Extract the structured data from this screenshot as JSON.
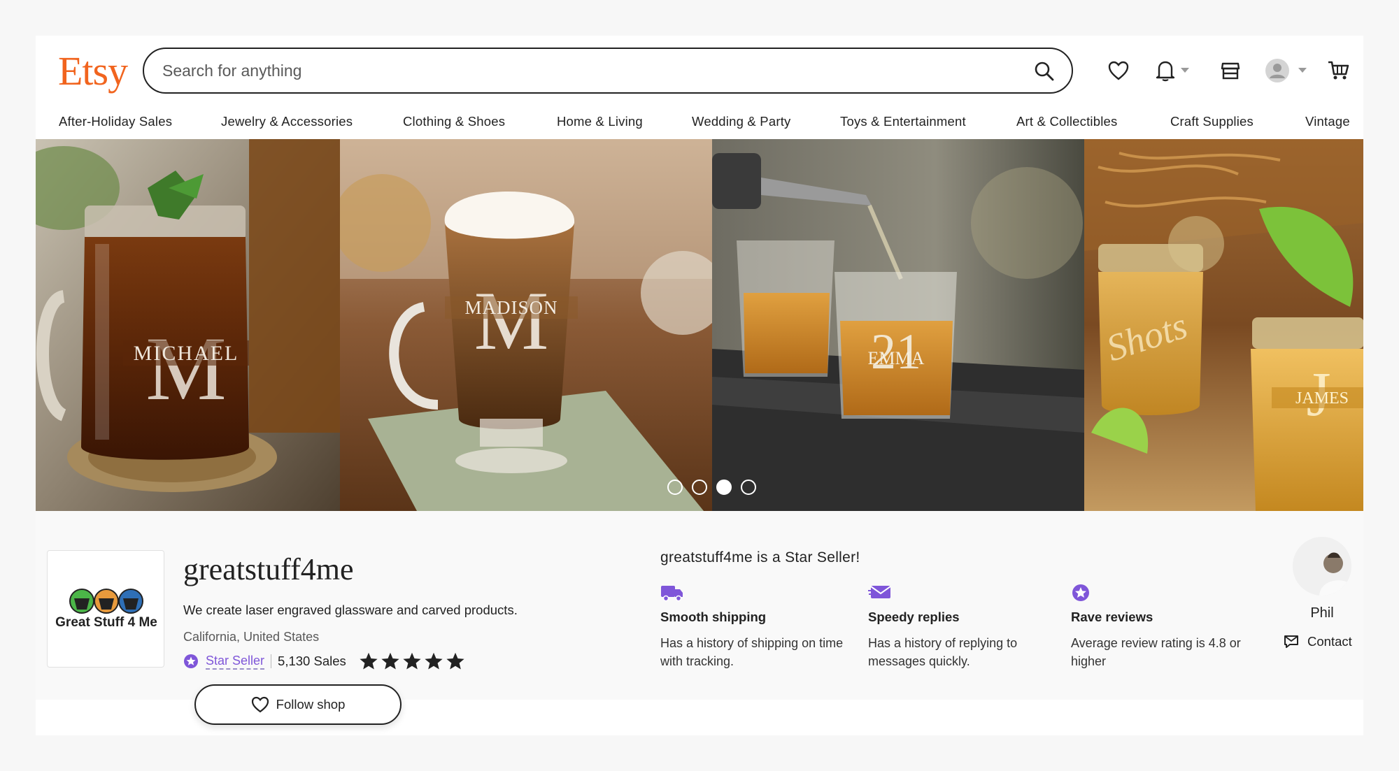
{
  "header": {
    "logo": "Etsy",
    "search_placeholder": "Search for anything"
  },
  "categories": [
    "After-Holiday Sales",
    "Jewelry & Accessories",
    "Clothing & Shoes",
    "Home & Living",
    "Wedding & Party",
    "Toys & Entertainment",
    "Art & Collectibles",
    "Craft Supplies",
    "Vintage"
  ],
  "banner": {
    "engravings": [
      "MICHAEL",
      "MADISON",
      "21",
      "EMMA",
      "Shots",
      "JAMES"
    ],
    "slide_count": 4,
    "active_slide": 3
  },
  "shop": {
    "logo_text": "Great Stuff 4 Me",
    "name": "greatstuff4me",
    "description": "We create laser engraved glassware and carved products.",
    "location": "California, United States",
    "star_seller_label": "Star Seller",
    "sales": "5,130 Sales",
    "rating": 5,
    "follow_label": "Follow shop"
  },
  "star_seller": {
    "heading": "greatstuff4me is a Star Seller!",
    "features": [
      {
        "title": "Smooth shipping",
        "description": "Has a history of shipping on time with tracking.",
        "icon": "truck-icon"
      },
      {
        "title": "Speedy replies",
        "description": "Has a history of replying to messages quickly.",
        "icon": "envelope-icon"
      },
      {
        "title": "Rave reviews",
        "description": "Average review rating is 4.8 or higher",
        "icon": "star-badge-icon"
      }
    ]
  },
  "owner": {
    "name": "Phil",
    "contact_label": "Contact"
  },
  "colors": {
    "brand": "#f1641e",
    "star_seller": "#7f56d9"
  }
}
